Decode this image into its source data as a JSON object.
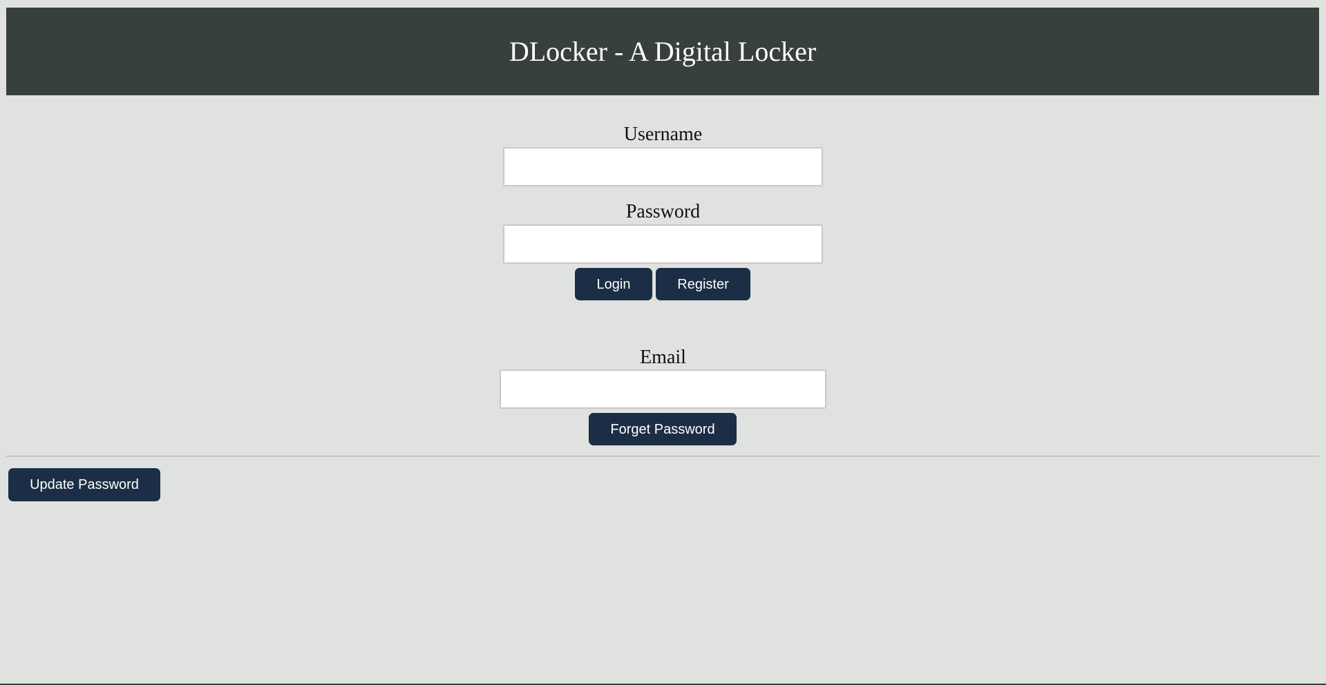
{
  "header": {
    "title": "DLocker - A Digital Locker"
  },
  "login": {
    "username_label": "Username",
    "username_value": "",
    "password_label": "Password",
    "password_value": "",
    "login_label": "Login",
    "register_label": "Register"
  },
  "reset": {
    "email_label": "Email",
    "email_value": "",
    "forget_label": "Forget Password"
  },
  "update": {
    "label": "Update Password"
  },
  "colors": {
    "background": "#e0e2e0",
    "header_background": "#38403e",
    "button_background": "#1b2e45",
    "button_text": "#ffffff"
  }
}
